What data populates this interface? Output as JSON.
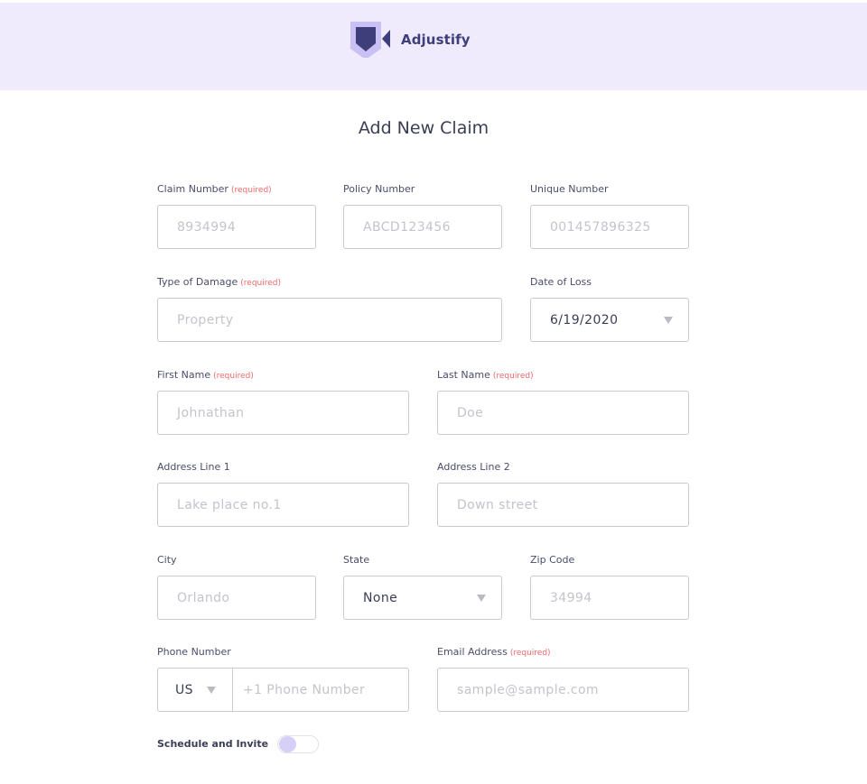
{
  "app": {
    "brand_name": "Adjustify",
    "logo_icon": "shield-play-logo-icon"
  },
  "page": {
    "title": "Add New Claim"
  },
  "required_text": "(required)",
  "fields": {
    "claim_number": {
      "label": "Claim Number",
      "placeholder": "8934994"
    },
    "policy_number": {
      "label": "Policy Number",
      "placeholder": "ABCD123456"
    },
    "unique_number": {
      "label": "Unique Number",
      "placeholder": "001457896325"
    },
    "type_of_damage": {
      "label": "Type of Damage",
      "placeholder": "Property"
    },
    "date_of_loss": {
      "label": "Date of Loss",
      "value": "6/19/2020"
    },
    "first_name": {
      "label": "First Name",
      "placeholder": "Johnathan"
    },
    "last_name": {
      "label": "Last Name",
      "placeholder": "Doe"
    },
    "address_line_1": {
      "label": "Address Line 1",
      "placeholder": "Lake place no.1"
    },
    "address_line_2": {
      "label": "Address Line 2",
      "placeholder": "Down street"
    },
    "city": {
      "label": "City",
      "placeholder": "Orlando"
    },
    "state": {
      "label": "State",
      "value": "None"
    },
    "zip_code": {
      "label": "Zip Code",
      "placeholder": "34994"
    },
    "phone_number": {
      "label": "Phone Number",
      "country": "US",
      "placeholder": "+1 Phone Number"
    },
    "email_address": {
      "label": "Email Address",
      "placeholder": "sample@sample.com"
    }
  },
  "schedule_toggle": {
    "label": "Schedule and Invite",
    "on": false
  },
  "colors": {
    "header_bg": "#efeafc",
    "brand_text": "#3e3f7a",
    "required": "#f06969",
    "border": "#c9c9cf",
    "placeholder": "#c3c4cc",
    "toggle_knob": "#d6cff6"
  }
}
